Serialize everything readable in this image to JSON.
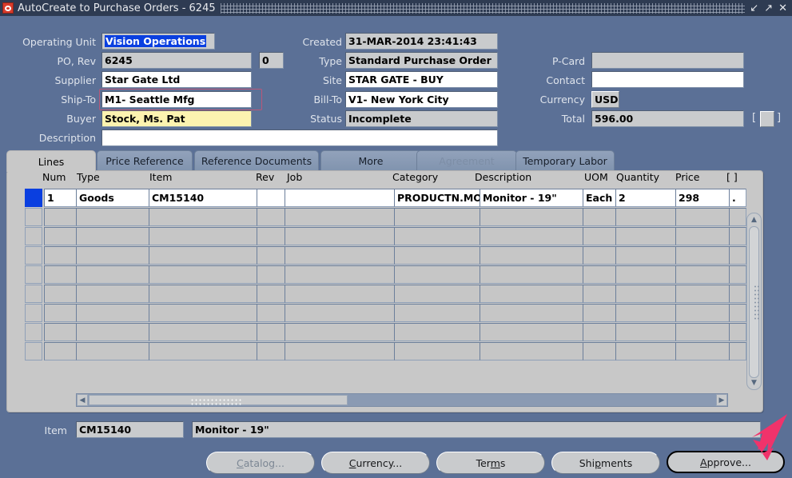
{
  "window": {
    "title": "AutoCreate to Purchase Orders - 6245",
    "app_icon": "oracle-forms-icon",
    "controls": [
      {
        "name": "minimize-button",
        "glyph": "↙"
      },
      {
        "name": "maximize-button",
        "glyph": "↗"
      },
      {
        "name": "close-button",
        "glyph": "✕"
      }
    ]
  },
  "header": {
    "fields": [
      {
        "key": "operating_unit",
        "label": "Operating Unit",
        "value": "Vision Operations",
        "style": "selected-lov"
      },
      {
        "key": "po",
        "label": "PO, Rev",
        "value": "6245",
        "style": "readonly"
      },
      {
        "key": "rev",
        "label": "",
        "value": "0",
        "style": "readonly"
      },
      {
        "key": "supplier",
        "label": "Supplier",
        "value": "Star Gate Ltd",
        "style": "editable"
      },
      {
        "key": "ship_to",
        "label": "Ship-To",
        "value": "M1- Seattle Mfg",
        "style": "editable",
        "highlighted": true
      },
      {
        "key": "buyer",
        "label": "Buyer",
        "value": "Stock, Ms. Pat",
        "style": "required"
      },
      {
        "key": "description",
        "label": "Description",
        "value": "",
        "style": "editable"
      },
      {
        "key": "created",
        "label": "Created",
        "value": "31-MAR-2014 23:41:43",
        "style": "readonly"
      },
      {
        "key": "type",
        "label": "Type",
        "value": "Standard Purchase Order",
        "style": "readonly"
      },
      {
        "key": "site",
        "label": "Site",
        "value": "STAR GATE - BUY",
        "style": "editable"
      },
      {
        "key": "bill_to",
        "label": "Bill-To",
        "value": "V1- New York City",
        "style": "editable"
      },
      {
        "key": "status",
        "label": "Status",
        "value": "Incomplete",
        "style": "readonly"
      },
      {
        "key": "pcard",
        "label": "P-Card",
        "value": "",
        "style": "readonly"
      },
      {
        "key": "contact",
        "label": "Contact",
        "value": "",
        "style": "editable"
      },
      {
        "key": "currency",
        "label": "Currency",
        "value": "USD",
        "style": "button"
      },
      {
        "key": "total",
        "label": "Total",
        "value": "596.00",
        "style": "readonly"
      }
    ],
    "total_bracket_left": "[",
    "total_bracket_right": "]"
  },
  "tabs": [
    {
      "label": "Lines",
      "active": true,
      "disabled": false
    },
    {
      "label": "Price Reference",
      "active": false,
      "disabled": false
    },
    {
      "label": "Reference Documents",
      "active": false,
      "disabled": false
    },
    {
      "label": "More",
      "active": false,
      "disabled": false
    },
    {
      "label": "Agreement",
      "active": false,
      "disabled": true
    },
    {
      "label": "Temporary Labor",
      "active": false,
      "disabled": false
    }
  ],
  "grid": {
    "columns": [
      "Num",
      "Type",
      "Item",
      "Rev",
      "Job",
      "Category",
      "Description",
      "UOM",
      "Quantity",
      "Price",
      "[ ]"
    ],
    "rows": [
      {
        "selected": true,
        "num": "1",
        "type": "Goods",
        "item": "CM15140",
        "rev": "",
        "job": "",
        "category": "PRODUCTN.MO",
        "description": "Monitor - 19\"",
        "uom": "Each",
        "quantity": "2",
        "price": "298",
        "flag": "."
      }
    ],
    "empty_row_count": 8
  },
  "footer": {
    "item_label": "Item",
    "item_value": "CM15140",
    "item_description": "Monitor - 19\"",
    "buttons": [
      {
        "name": "catalog-button",
        "label": "Catalog...",
        "mnemonic_index": 0,
        "disabled": true,
        "default": false
      },
      {
        "name": "currency-button",
        "label": "Currency...",
        "mnemonic_index": 0,
        "disabled": false,
        "default": false
      },
      {
        "name": "terms-button",
        "label": "Terms",
        "mnemonic_index": 2,
        "disabled": false,
        "default": false
      },
      {
        "name": "shipments-button",
        "label": "Shipments",
        "mnemonic_index": 4,
        "disabled": false,
        "default": false
      },
      {
        "name": "approve-button",
        "label": "Approve...",
        "mnemonic_index": 0,
        "disabled": false,
        "default": true
      }
    ]
  },
  "annotation": {
    "arrow_color": "#f0336b",
    "points_at": "approve-button"
  },
  "colors": {
    "window_background": "#5b7096",
    "titlebar": "#2e3b52",
    "panel": "#c8c8c8",
    "field_readonly": "#c9cbcd",
    "field_editable": "#ffffff",
    "field_required": "#fcf3b0",
    "selection": "#0a3fe0",
    "highlight_outline": "#b8587a"
  }
}
